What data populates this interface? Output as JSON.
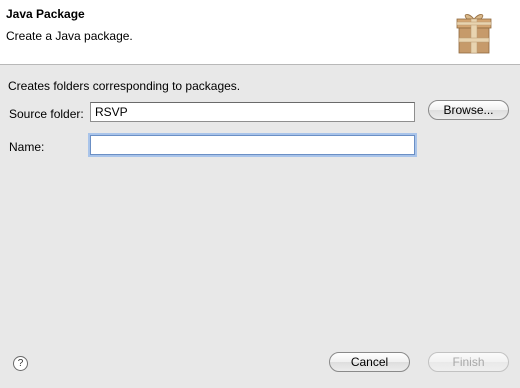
{
  "header": {
    "title": "Java Package",
    "subtitle": "Create a Java package.",
    "icon": "package-box-icon"
  },
  "form": {
    "description": "Creates folders corresponding to packages.",
    "source_folder_label": "Source folder:",
    "source_folder_value": "RSVP",
    "name_label": "Name:",
    "name_value": ""
  },
  "buttons": {
    "browse": "Browse...",
    "cancel": "Cancel",
    "finish": "Finish",
    "help": "?"
  },
  "colors": {
    "focus_ring": "#a9c4ea",
    "disabled_text": "#a8a8a8",
    "box_fill": "#c69a6a",
    "box_strap": "#e8d4b0"
  }
}
